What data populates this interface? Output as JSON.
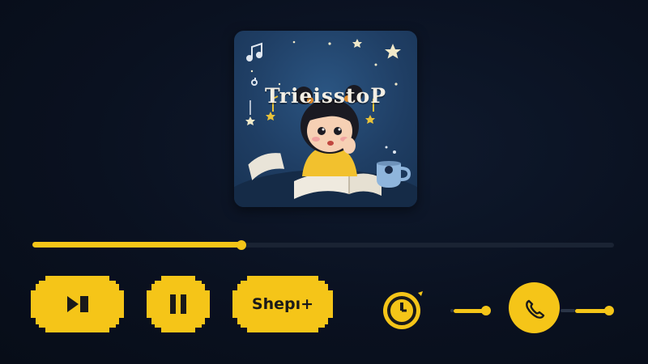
{
  "album": {
    "title": "TrieisstoP",
    "cover_colors": {
      "background": "#1f3e64",
      "shirt": "#f2c12e"
    }
  },
  "playback": {
    "progress_fraction": 0.36
  },
  "controls": {
    "skip_icon": "next-track-icon",
    "pause_icon": "pause-icon",
    "action_label": "Shepı+",
    "timer_icon": "timer-icon",
    "call_icon": "phone-icon"
  },
  "volume": {
    "level_fraction": 0.2
  },
  "colors": {
    "accent": "#f5c518",
    "background": "#0a1120",
    "track": "#1a2333"
  }
}
